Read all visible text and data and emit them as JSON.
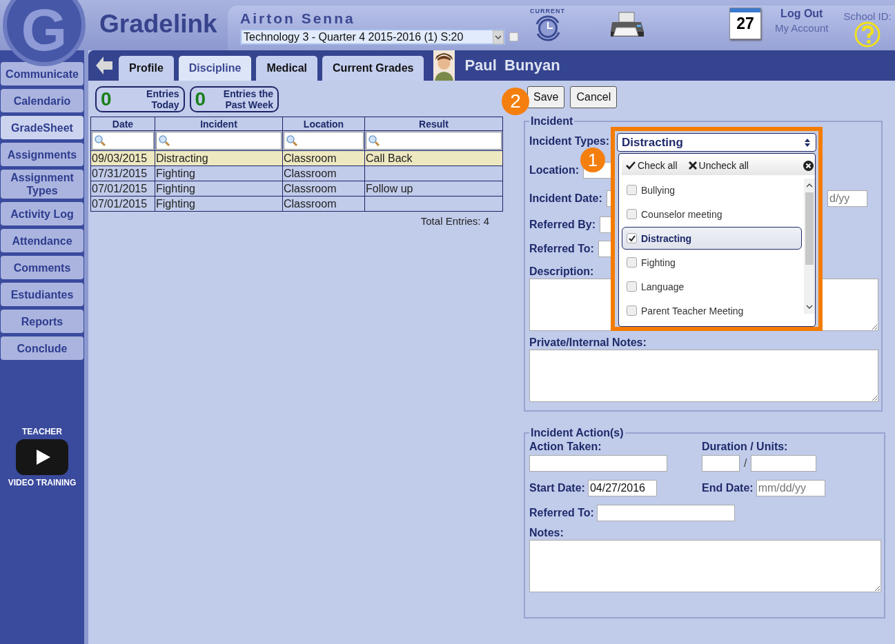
{
  "app": {
    "logo_letter": "G",
    "logo_text": "Gradelink"
  },
  "header": {
    "teacher_name": "Airton Senna",
    "class_select": {
      "value": "Technology 3 - Quarter 4 2015-2016 (1) S:20"
    },
    "current_checkbox": {
      "checked": false
    },
    "current_label": "CURRENT",
    "calendar_day": "27",
    "log_out": "Log Out",
    "my_account": "My Account",
    "school_id_label": "School ID:"
  },
  "sidebar": {
    "items": [
      {
        "label": "Communicate",
        "selected": false
      },
      {
        "label": "Calendario",
        "selected": false
      },
      {
        "label": "GradeSheet",
        "selected": true
      },
      {
        "label": "Assignments",
        "selected": false
      },
      {
        "label": "Assignment Types",
        "selected": false
      },
      {
        "label": "Activity Log",
        "selected": false
      },
      {
        "label": "Attendance",
        "selected": false
      },
      {
        "label": "Comments",
        "selected": false
      },
      {
        "label": "Estudiantes",
        "selected": false
      },
      {
        "label": "Reports",
        "selected": false
      },
      {
        "label": "Conclude",
        "selected": false
      }
    ],
    "video": {
      "top": "TEACHER",
      "bottom": "VIDEO TRAINING"
    }
  },
  "tabs": [
    {
      "label": "Profile",
      "selected": false
    },
    {
      "label": "Discipline",
      "selected": true
    },
    {
      "label": "Medical",
      "selected": false
    },
    {
      "label": "Current Grades",
      "selected": false
    }
  ],
  "student_name": "Paul Bunyan",
  "counters": [
    {
      "count": "0",
      "label": "Entries Today"
    },
    {
      "count": "0",
      "label": "Entries the Past Week"
    }
  ],
  "table": {
    "columns": [
      "Date",
      "Incident",
      "Location",
      "Result"
    ],
    "rows": [
      {
        "cells": [
          "09/03/2015",
          "Distracting",
          "Classroom",
          "Call Back"
        ],
        "selected": true
      },
      {
        "cells": [
          "07/31/2015",
          "Fighting",
          "Classroom",
          ""
        ],
        "selected": false
      },
      {
        "cells": [
          "07/01/2015",
          "Fighting",
          "Classroom",
          "Follow up"
        ],
        "selected": false
      },
      {
        "cells": [
          "07/01/2015",
          "Fighting",
          "Classroom",
          ""
        ],
        "selected": false
      }
    ]
  },
  "total": "Total Entries: 4",
  "buttons": [
    {
      "label": "Save"
    },
    {
      "label": "Cancel"
    }
  ],
  "incident": {
    "legend": "Incident",
    "types_label": "Incident Types:",
    "location_label": "Location:",
    "date_label": "Incident Date:",
    "date_end_placeholder": "d/yy",
    "referred_by_label": "Referred By:",
    "referred_to_label": "Referred To:",
    "description_label": "Description:",
    "notes_label": "Private/Internal Notes:"
  },
  "types_dropdown": {
    "value": "Distracting",
    "check_all": "Check all",
    "uncheck_all": "Uncheck all",
    "options": [
      {
        "label": "Bullying",
        "checked": false
      },
      {
        "label": "Counselor meeting",
        "checked": false
      },
      {
        "label": "Distracting",
        "checked": true
      },
      {
        "label": "Fighting",
        "checked": false
      },
      {
        "label": "Language",
        "checked": false
      },
      {
        "label": "Parent Teacher Meeting",
        "checked": false
      }
    ]
  },
  "actions": {
    "legend": "Incident Action(s)",
    "action_label": "Action Taken:",
    "duration_label": "Duration / Units:",
    "separator": "/",
    "start_label": "Start Date:",
    "start_value": "04/27/2016",
    "end_label": "End Date:",
    "end_placeholder": "mm/dd/yy",
    "referred_to_label": "Referred To:",
    "notes_label": "Notes:"
  },
  "callouts": [
    {
      "label": "1"
    },
    {
      "label": "2"
    }
  ]
}
